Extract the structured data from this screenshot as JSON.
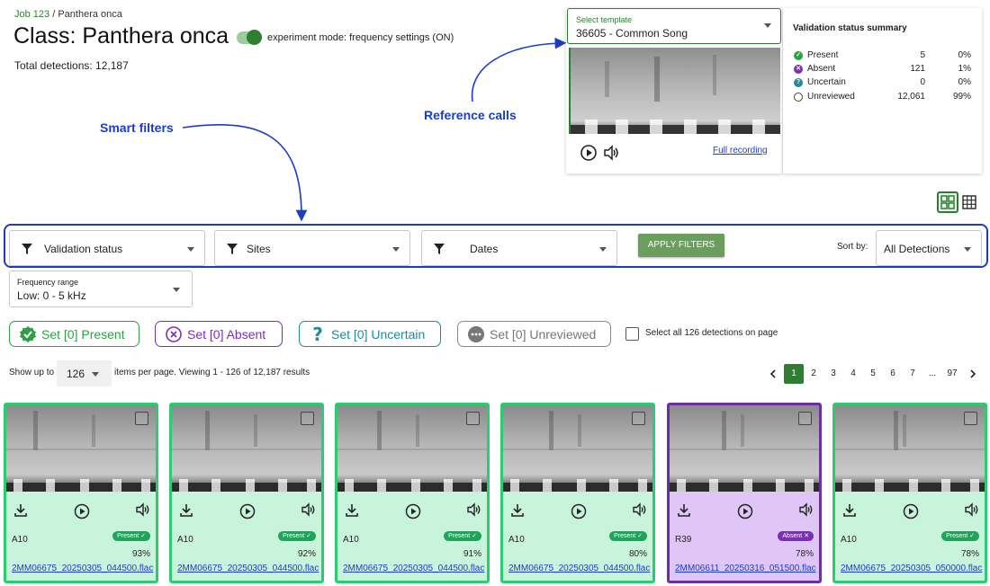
{
  "breadcrumb": {
    "job": "Job 123",
    "separator": "/",
    "current": "Panthera onca"
  },
  "page_title": "Class: Panthera onca",
  "mode_label": "experiment mode: frequency settings (ON)",
  "total_detections": "Total detections: 12,187",
  "annotations": {
    "smart_filters": "Smart filters",
    "reference_calls": "Reference calls"
  },
  "reference": {
    "select_label": "Select template",
    "select_value": "36605 - Common Song",
    "full_recording": "Full recording"
  },
  "summary": {
    "title": "Validation status summary",
    "rows": [
      {
        "name": "Present",
        "count": "5",
        "pct": "0%",
        "color": "#2ea043",
        "icon": "check-icon"
      },
      {
        "name": "Absent",
        "count": "121",
        "pct": "1%",
        "color": "#7b2fb5",
        "icon": "x-icon"
      },
      {
        "name": "Uncertain",
        "count": "0",
        "pct": "0%",
        "color": "#1f8a9a",
        "icon": "question-icon"
      },
      {
        "name": "Unreviewed",
        "count": "12,061",
        "pct": "99%",
        "color": "#ffffff",
        "icon": "circle-icon"
      }
    ]
  },
  "filters": {
    "validation_status": "Validation status",
    "sites": "Sites",
    "dates": "Dates",
    "apply": "APPLY FILTERS",
    "sort_label": "Sort by:",
    "sort_value": "All Detections"
  },
  "frequency": {
    "label": "Frequency range",
    "value": "Low: 0 - 5 kHz"
  },
  "set_buttons": [
    {
      "label": "Set [0] Present",
      "color": "#2ea043",
      "icon": "check-badge-icon"
    },
    {
      "label": "Set [0] Absent",
      "color": "#7b2fb5",
      "icon": "circle-x-icon"
    },
    {
      "label": "Set [0] Uncertain",
      "color": "#1f8a9a",
      "icon": "question-icon"
    },
    {
      "label": "Set [0] Unreviewed",
      "color": "#888888",
      "icon": "dots-circle-icon"
    }
  ],
  "select_all": "Select all 126 detections on page",
  "paging": {
    "show_label": "Show up to",
    "per_page": "126",
    "results": "items per page. Viewing 1 - 126 of 12,187 results",
    "pages": [
      "1",
      "2",
      "3",
      "4",
      "5",
      "6",
      "7",
      "...",
      "97"
    ],
    "current_page": "1"
  },
  "cards": [
    {
      "site": "A10",
      "status": "Present",
      "score": "93%",
      "file": "2MM06675_20250305_044500.flac"
    },
    {
      "site": "A10",
      "status": "Present",
      "score": "92%",
      "file": "2MM06675_20250305_044500.flac"
    },
    {
      "site": "A10",
      "status": "Present",
      "score": "91%",
      "file": "2MM06675_20250305_044500.flac"
    },
    {
      "site": "A10",
      "status": "Present",
      "score": "80%",
      "file": "2MM06675_20250305_044500.flac"
    },
    {
      "site": "R39",
      "status": "Absent",
      "score": "78%",
      "file": "2MM06611_20250316_051500.flac"
    },
    {
      "site": "A10",
      "status": "Present",
      "score": "78%",
      "file": "2MM06675_20250305_050000.flac"
    }
  ],
  "colors": {
    "present_border": "#2ecc71",
    "present_bg": "#c9f4dc",
    "absent_border": "#6a2fa3",
    "absent_bg": "#e0c6f7",
    "accent_green": "#2e7d32",
    "annotation_blue": "#1d3cc4"
  }
}
